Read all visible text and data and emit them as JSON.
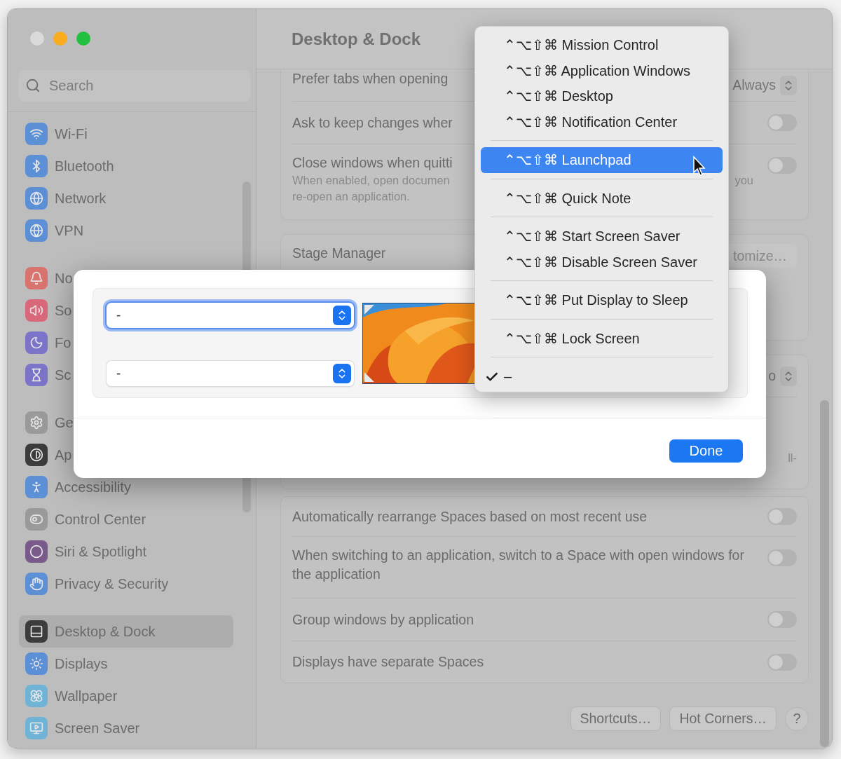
{
  "window": {
    "traffic_lights": [
      {
        "color": "#dadada"
      },
      {
        "color": "#f8ac1e"
      },
      {
        "color": "#22c03f"
      }
    ]
  },
  "sidebar": {
    "search": {
      "placeholder": "Search"
    },
    "groups": [
      [
        {
          "label": "Wi-Fi",
          "color": "#5b8fd6",
          "selected": false
        },
        {
          "label": "Bluetooth",
          "color": "#5b8fd6",
          "selected": false
        },
        {
          "label": "Network",
          "color": "#5b8fd6",
          "selected": false
        },
        {
          "label": "VPN",
          "color": "#5b8fd6",
          "selected": false
        }
      ],
      [
        {
          "label": "No",
          "color": "#d9736e",
          "selected": false
        },
        {
          "label": "So",
          "color": "#d9697a",
          "selected": false
        },
        {
          "label": "Fo",
          "color": "#7b74c9",
          "selected": false
        },
        {
          "label": "Sc",
          "color": "#7b74c9",
          "selected": false
        }
      ],
      [
        {
          "label": "Ge",
          "color": "#9a9a9a",
          "selected": false
        },
        {
          "label": "Ap",
          "color": "#3c3c3c",
          "selected": false
        },
        {
          "label": "Accessibility",
          "color": "#5b8fd6",
          "selected": false
        },
        {
          "label": "Control Center",
          "color": "#9a9a9a",
          "selected": false
        },
        {
          "label": "Siri & Spotlight",
          "color": "#7a5a8a",
          "selected": false
        },
        {
          "label": "Privacy & Security",
          "color": "#5b8fd6",
          "selected": false
        }
      ],
      [
        {
          "label": "Desktop & Dock",
          "color": "#3c3c3c",
          "selected": true
        },
        {
          "label": "Displays",
          "color": "#5b8fd6",
          "selected": false
        },
        {
          "label": "Wallpaper",
          "color": "#6fb3d6",
          "selected": false
        },
        {
          "label": "Screen Saver",
          "color": "#6fb3d6",
          "selected": false
        }
      ]
    ]
  },
  "main": {
    "title": "Desktop & Dock",
    "cards": [
      {
        "rows": [
          {
            "kind": "popup",
            "label": "Prefer tabs when opening",
            "value": "Always"
          },
          {
            "kind": "toggle",
            "label": "Ask to keep changes wher",
            "on": false
          },
          {
            "kind": "toggle",
            "label": "Close windows when quitti",
            "on": false,
            "description": [
              {
                "start": "When enabled, open documen",
                "end": "you"
              },
              {
                "start": "re-open an application."
              }
            ]
          }
        ]
      },
      {
        "rows": [
          {
            "kind": "button",
            "label": "Stage Manager",
            "button": "tomize…"
          }
        ]
      },
      {
        "rows": [
          {
            "kind": "popup",
            "value": "o"
          },
          {
            "kind": "note",
            "text": "ll-"
          }
        ]
      },
      {
        "rows": [
          {
            "kind": "toggle",
            "label": "Automatically rearrange Spaces based on most recent use",
            "on": false
          },
          {
            "kind": "toggle",
            "label": "When switching to an application, switch to a Space with open windows for the application",
            "on": false
          },
          {
            "kind": "toggle",
            "label": "Group windows by application",
            "on": false
          },
          {
            "kind": "toggle",
            "label": "Displays have separate Spaces",
            "on": false
          }
        ]
      }
    ],
    "buttons": [
      "Shortcuts…",
      "Hot Corners…"
    ],
    "help": "?"
  },
  "dialog": {
    "corners": [
      {
        "value": "-",
        "focused": true
      },
      {
        "value": "-",
        "focused": false
      }
    ],
    "button": "Done"
  },
  "menu": {
    "groups": [
      [
        {
          "label": "⌃⌥⇧⌘ Mission Control",
          "selected": false,
          "checked": false
        },
        {
          "label": "⌃⌥⇧⌘ Application Windows",
          "selected": false,
          "checked": false
        },
        {
          "label": "⌃⌥⇧⌘ Desktop",
          "selected": false,
          "checked": false
        },
        {
          "label": "⌃⌥⇧⌘ Notification Center",
          "selected": false,
          "checked": false
        }
      ],
      [
        {
          "label": "⌃⌥⇧⌘ Launchpad",
          "selected": true,
          "checked": false
        }
      ],
      [
        {
          "label": "⌃⌥⇧⌘ Quick Note",
          "selected": false,
          "checked": false
        }
      ],
      [
        {
          "label": "⌃⌥⇧⌘ Start Screen Saver",
          "selected": false,
          "checked": false
        },
        {
          "label": "⌃⌥⇧⌘ Disable Screen Saver",
          "selected": false,
          "checked": false
        }
      ],
      [
        {
          "label": "⌃⌥⇧⌘ Put Display to Sleep",
          "selected": false,
          "checked": false
        }
      ],
      [
        {
          "label": "⌃⌥⇧⌘ Lock Screen",
          "selected": false,
          "checked": false
        }
      ],
      [
        {
          "label": "–",
          "selected": false,
          "checked": true
        }
      ]
    ]
  }
}
